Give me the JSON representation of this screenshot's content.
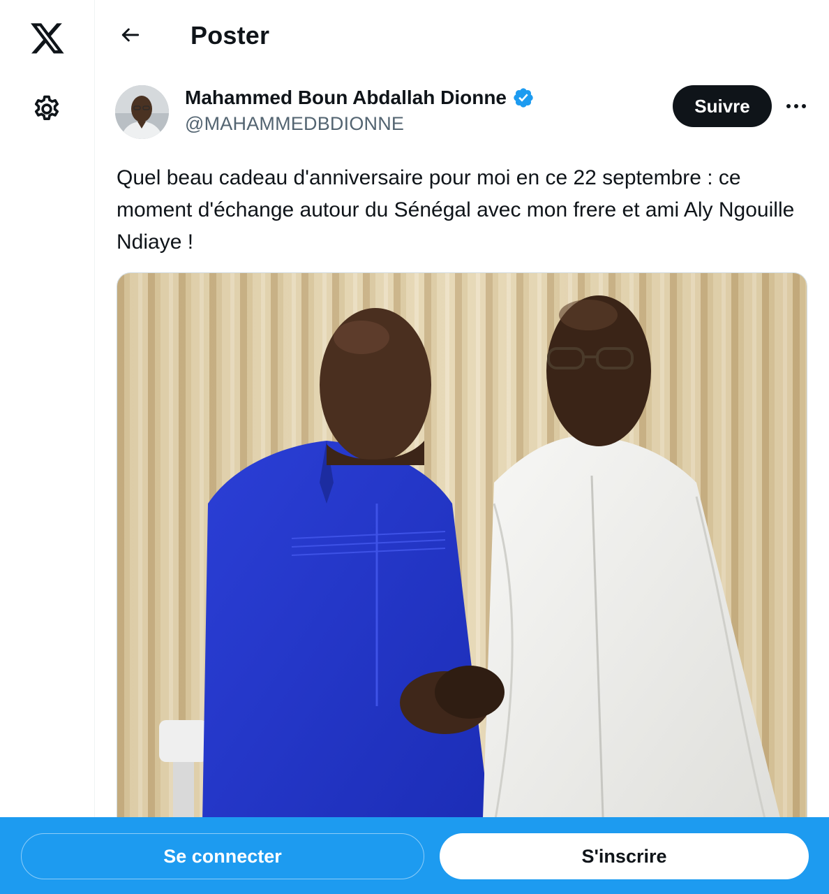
{
  "nav": {
    "logo_icon": "x-logo-icon",
    "settings_icon": "gear-icon"
  },
  "header": {
    "back_icon": "arrow-left-icon",
    "title": "Poster"
  },
  "tweet": {
    "author_name": "Mahammed Boun Abdallah Dionne",
    "verified_icon": "verified-badge-icon",
    "handle": "@MAHAMMEDBDIONNE",
    "follow_label": "Suivre",
    "more_icon": "more-options-icon",
    "text": "Quel beau cadeau d'anniversaire pour moi en ce 22 septembre : ce moment d'échange autour du Sénégal avec mon frere et ami Aly Ngouille Ndiaye !"
  },
  "bottom_bar": {
    "login_label": "Se connecter",
    "signup_label": "S'inscrire"
  },
  "colors": {
    "accent": "#1d9bf0",
    "text_primary": "#0f1419",
    "text_secondary": "#536471"
  }
}
